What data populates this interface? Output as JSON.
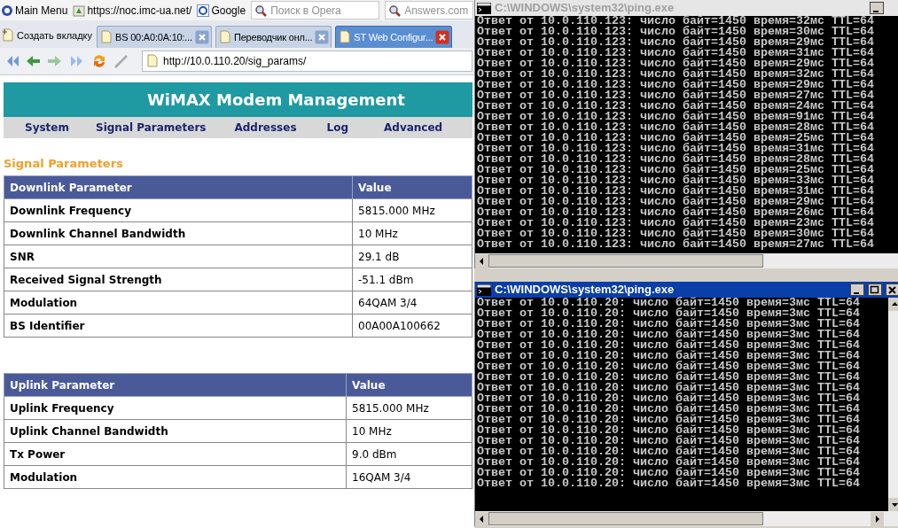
{
  "browser": {
    "bookmarks": [
      {
        "label": "Main Menu"
      },
      {
        "label": "https://noc.imc-ua.net/"
      },
      {
        "label": "Google"
      }
    ],
    "search_fields": [
      {
        "placeholder": "Поиск в Opera"
      },
      {
        "placeholder": "Answers.com"
      }
    ],
    "new_tab": "Создать вкладку",
    "tabs": [
      {
        "label": "BS 00:A0:0A:10:...",
        "selected": false
      },
      {
        "label": "Переводчик онл...",
        "selected": false
      },
      {
        "label": "ST Web Configur...",
        "selected": true
      }
    ],
    "address": "http://10.0.110.20/sig_params/"
  },
  "page": {
    "banner": "WiMAX Modem Management",
    "nav": [
      "System",
      "Signal Parameters",
      "Addresses",
      "Log",
      "Advanced"
    ],
    "heading": "Signal Parameters",
    "tables": [
      {
        "columns": [
          "Downlink Parameter",
          "Value"
        ],
        "rows": [
          [
            "Downlink Frequency",
            "5815.000 MHz"
          ],
          [
            "Downlink Channel Bandwidth",
            "10 MHz"
          ],
          [
            "SNR",
            "29.1 dB"
          ],
          [
            "Received Signal Strength",
            "-51.1 dBm"
          ],
          [
            "Modulation",
            "64QAM 3/4"
          ],
          [
            "BS Identifier",
            "00A00A100662"
          ]
        ]
      },
      {
        "columns": [
          "Uplink Parameter",
          "Value"
        ],
        "rows": [
          [
            "Uplink Frequency",
            "5815.000 MHz"
          ],
          [
            "Uplink Channel Bandwidth",
            "10 MHz"
          ],
          [
            "Tx Power",
            "9.0 dBm"
          ],
          [
            "Modulation",
            "16QAM 3/4"
          ]
        ]
      }
    ]
  },
  "consoles": [
    {
      "title": "C:\\WINDOWS\\system32\\ping.exe",
      "active": false,
      "lines": [
        "Ответ от 10.0.110.123: число байт=1450 время=32мс TTL=64",
        "Ответ от 10.0.110.123: число байт=1450 время=30мс TTL=64",
        "Ответ от 10.0.110.123: число байт=1450 время=29мс TTL=64",
        "Ответ от 10.0.110.123: число байт=1450 время=31мс TTL=64",
        "Ответ от 10.0.110.123: число байт=1450 время=29мс TTL=64",
        "Ответ от 10.0.110.123: число байт=1450 время=32мс TTL=64",
        "Ответ от 10.0.110.123: число байт=1450 время=29мс TTL=64",
        "Ответ от 10.0.110.123: число байт=1450 время=27мс TTL=64",
        "Ответ от 10.0.110.123: число байт=1450 время=24мс TTL=64",
        "Ответ от 10.0.110.123: число байт=1450 время=91мс TTL=64",
        "Ответ от 10.0.110.123: число байт=1450 время=28мс TTL=64",
        "Ответ от 10.0.110.123: число байт=1450 время=25мс TTL=64",
        "Ответ от 10.0.110.123: число байт=1450 время=31мс TTL=64",
        "Ответ от 10.0.110.123: число байт=1450 время=28мс TTL=64",
        "Ответ от 10.0.110.123: число байт=1450 время=25мс TTL=64",
        "Ответ от 10.0.110.123: число байт=1450 время=33мс TTL=64",
        "Ответ от 10.0.110.123: число байт=1450 время=31мс TTL=64",
        "Ответ от 10.0.110.123: число байт=1450 время=29мс TTL=64",
        "Ответ от 10.0.110.123: число байт=1450 время=26мс TTL=64",
        "Ответ от 10.0.110.123: число байт=1450 время=23мс TTL=64",
        "Ответ от 10.0.110.123: число байт=1450 время=30мс TTL=64",
        "Ответ от 10.0.110.123: число байт=1450 время=27мс TTL=64"
      ]
    },
    {
      "title": "C:\\WINDOWS\\system32\\ping.exe",
      "active": true,
      "lines": [
        "Ответ от 10.0.110.20: число байт=1450 время=3мс TTL=64",
        "Ответ от 10.0.110.20: число байт=1450 время=3мс TTL=64",
        "Ответ от 10.0.110.20: число байт=1450 время=3мс TTL=64",
        "Ответ от 10.0.110.20: число байт=1450 время=3мс TTL=64",
        "Ответ от 10.0.110.20: число байт=1450 время=3мс TTL=64",
        "Ответ от 10.0.110.20: число байт=1450 время=3мс TTL=64",
        "Ответ от 10.0.110.20: число байт=1450 время=3мс TTL=64",
        "Ответ от 10.0.110.20: число байт=1450 время=3мс TTL=64",
        "Ответ от 10.0.110.20: число байт=1450 время=3мс TTL=64",
        "Ответ от 10.0.110.20: число байт=1450 время=3мс TTL=64",
        "Ответ от 10.0.110.20: число байт=1450 время=3мс TTL=64",
        "Ответ от 10.0.110.20: число байт=1450 время=3мс TTL=64",
        "Ответ от 10.0.110.20: число байт=1450 время=3мс TTL=64",
        "Ответ от 10.0.110.20: число байт=1450 время=3мс TTL=64",
        "Ответ от 10.0.110.20: число байт=1450 время=3мс TTL=64",
        "Ответ от 10.0.110.20: число байт=1450 время=3мс TTL=64",
        "Ответ от 10.0.110.20: число байт=1450 время=3мс TTL=64",
        "Ответ от 10.0.110.20: число байт=1450 время=3мс TTL=64"
      ]
    }
  ]
}
